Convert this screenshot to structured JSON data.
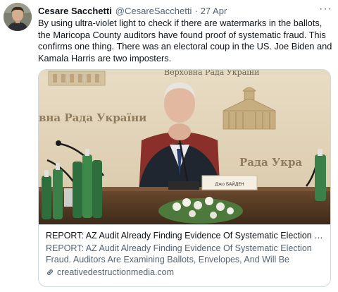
{
  "tweet": {
    "display_name": "Cesare Sacchetti",
    "handle": "@CesareSacchetti",
    "separator": "·",
    "date": "27 Apr",
    "more_label": "···",
    "text": "By using ultra-violet light to check if there are watermarks in the ballots, the Maricopa County auditors have found proof of systematic fraud. This confirms one thing. There was an electoral coup in the US. Joe Biden and Kamala Harris are two imposters."
  },
  "card": {
    "image_texts": {
      "banner_top": "Верховна Рада України",
      "wall_left": "вна Рада України",
      "wall_right": "Рада Укра",
      "nameplate": "Джо БАЙДЕН"
    },
    "title": "REPORT: AZ Audit Already Finding Evidence Of Systematic Election Fra...",
    "description": "REPORT: AZ Audit Already Finding Evidence Of Systematic Election Fraud. Auditors Are Examining Ballots, Envelopes, And Will Be Verifying...",
    "domain": "creativedestructionmedia.com",
    "domain_icon": "link-icon"
  },
  "colors": {
    "text_primary": "#0f1419",
    "text_secondary": "#536471",
    "border": "#cfd9de"
  }
}
